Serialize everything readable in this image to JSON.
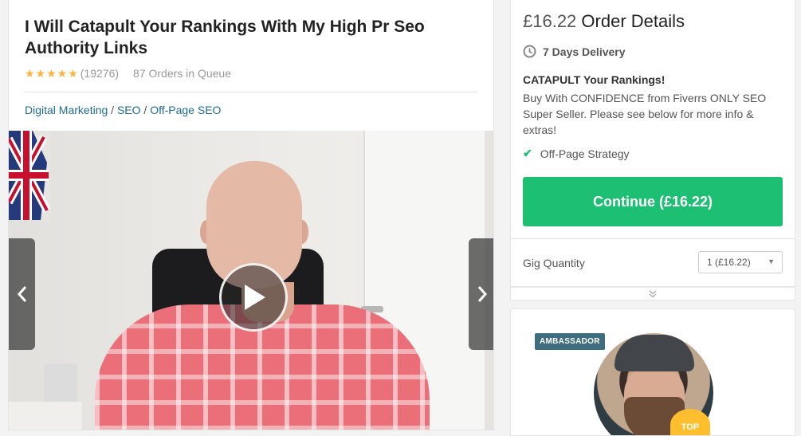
{
  "gig": {
    "title": "I Will Catapult Your Rankings With My High Pr Seo Authority Links",
    "stars": "★★★★★",
    "rating_count": "(19276)",
    "queue": "87 Orders in Queue",
    "breadcrumb": {
      "cat1": "Digital Marketing",
      "sep1": "/",
      "cat2": "SEO",
      "sep2": "/",
      "cat3": "Off-Page SEO"
    },
    "icons": {
      "play": "play-icon",
      "prev": "chevron-left-icon",
      "next": "chevron-right-icon"
    }
  },
  "order": {
    "price": "£16.22",
    "heading": "Order Details",
    "delivery": "7 Days Delivery",
    "package_title": "CATAPULT Your Rankings!",
    "package_desc": "Buy With CONFIDENCE from Fiverrs ONLY SEO Super Seller. Please see below for more info & extras!",
    "feature": "Off-Page Strategy",
    "continue_label": "Continue (£16.22)",
    "quantity_label": "Gig Quantity",
    "quantity_value": "1 (£16.22)",
    "colors": {
      "accent": "#1dbf73",
      "star": "#ffb33e",
      "link": "#1d6c8e"
    }
  },
  "seller": {
    "badge": "AMBASSADOR",
    "top_badge": "TOP"
  }
}
